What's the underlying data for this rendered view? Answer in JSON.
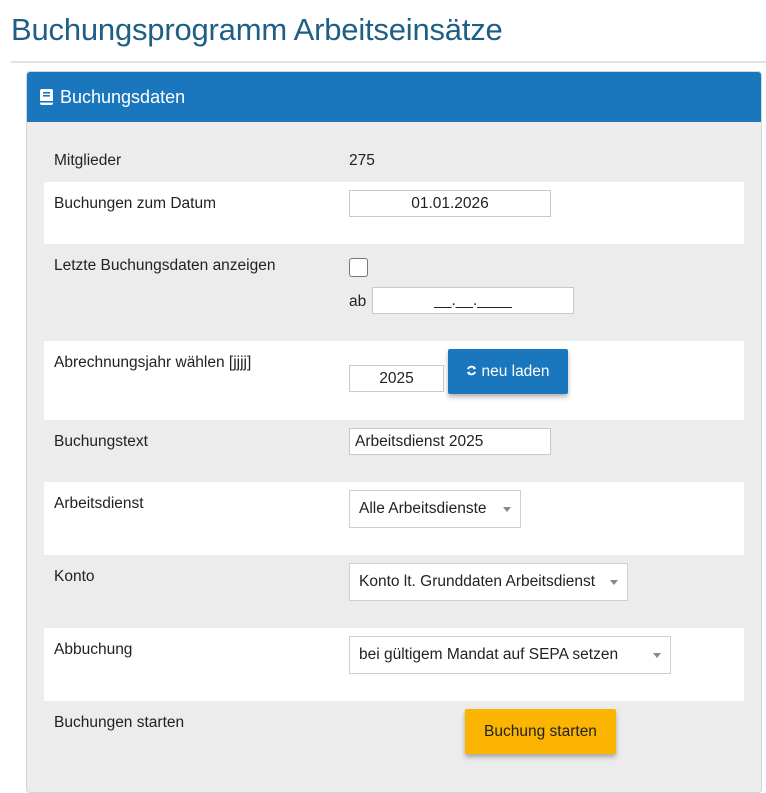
{
  "page": {
    "title": "Buchungsprogramm Arbeitseinsätze"
  },
  "panel": {
    "title": "Buchungsdaten",
    "icon": "book-icon"
  },
  "rows": {
    "mitglieder": {
      "label": "Mitglieder",
      "value": "275"
    },
    "datum": {
      "label": "Buchungen zum Datum",
      "value": "01.01.2026"
    },
    "letzte": {
      "label": "Letzte Buchungsdaten anzeigen",
      "ab_label": "ab",
      "ab_value": "__.__.____",
      "checked": false
    },
    "jahr": {
      "label": "Abrechnungsjahr wählen [jjjj]",
      "value": "2025",
      "reload_label": "neu laden",
      "reload_icon": "refresh-icon"
    },
    "text": {
      "label": "Buchungstext",
      "value": "Arbeitsdienst 2025"
    },
    "arbeitsdienst": {
      "label": "Arbeitsdienst",
      "selected": "Alle Arbeitsdienste"
    },
    "konto": {
      "label": "Konto",
      "selected": "Konto lt. Grunddaten Arbeitsdienst"
    },
    "abbuchung": {
      "label": "Abbuchung",
      "selected": "bei gültigem Mandat auf SEPA setzen"
    },
    "starten": {
      "label": "Buchungen starten",
      "button_label": "Buchung starten"
    }
  },
  "colors": {
    "primary": "#1a77be",
    "title": "#1e5f86",
    "warning": "#fbb400"
  }
}
